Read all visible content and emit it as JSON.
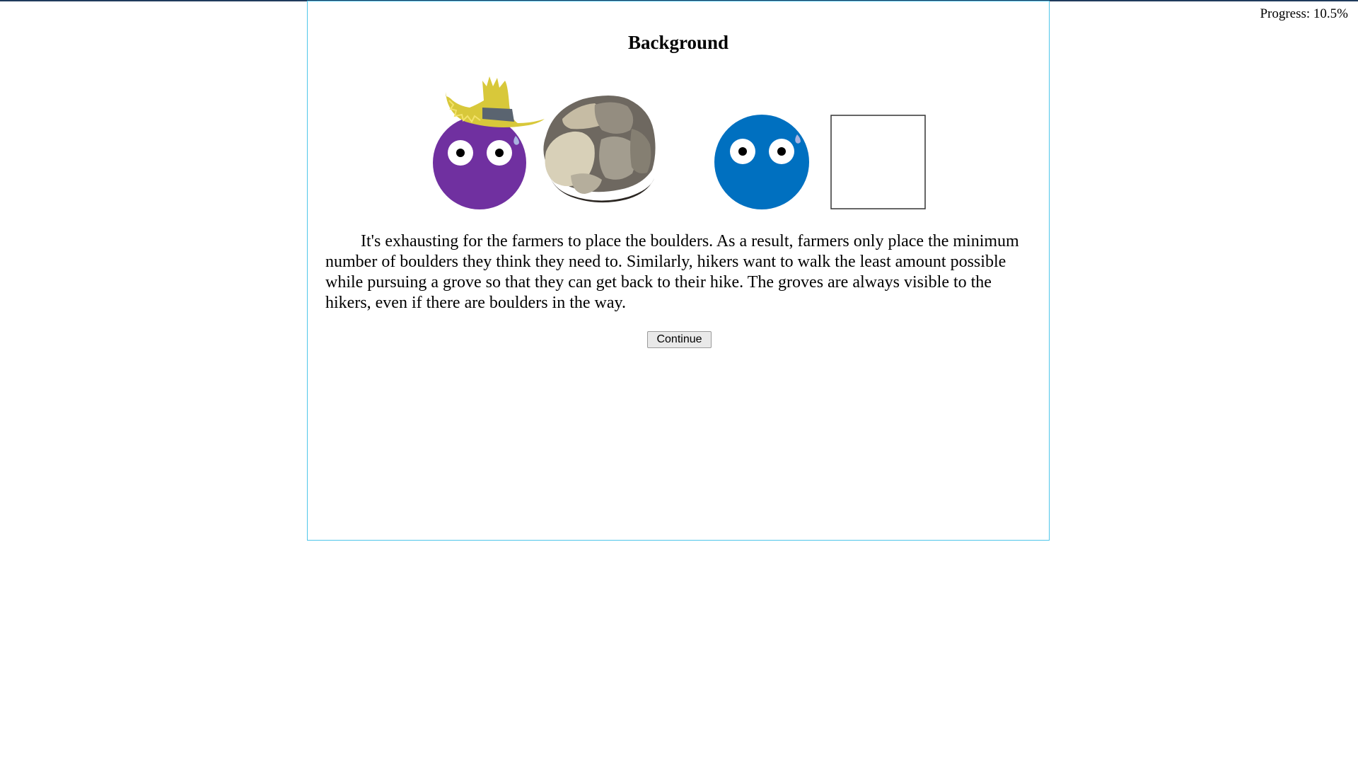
{
  "progress": {
    "text": "Progress: 10.5%"
  },
  "panel": {
    "title": "Background",
    "body": "It's exhausting for the farmers to place the boulders. As a result, farmers only place the minimum number of boulders they think they need to. Similarly, hikers want to walk the least amount possible while pursuing a grove so that they can get back to their hike. The groves are always visible to the hikers, even if there are boulders in the way.",
    "continue_label": "Continue"
  },
  "illustration": {
    "farmer_color": "#7030a0",
    "hiker_color": "#0070c0",
    "hat_color": "#d8c83a",
    "hat_band_color": "#5a6470"
  }
}
